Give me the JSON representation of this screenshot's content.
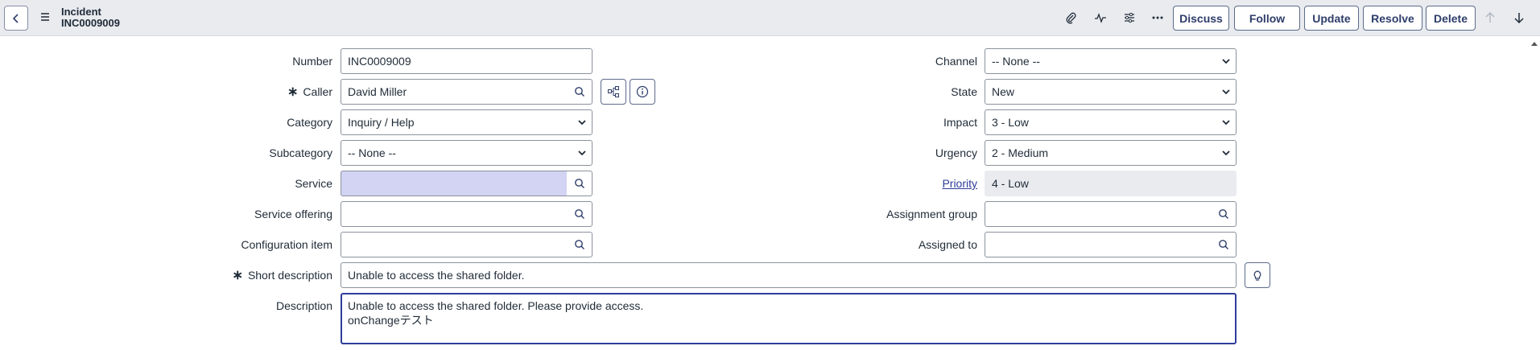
{
  "header": {
    "record_type": "Incident",
    "record_number": "INC0009009",
    "buttons": {
      "discuss": "Discuss",
      "follow": "Follow",
      "update": "Update",
      "resolve": "Resolve",
      "delete": "Delete"
    }
  },
  "form": {
    "number": {
      "label": "Number",
      "value": "INC0009009"
    },
    "caller": {
      "label": "Caller",
      "value": "David Miller"
    },
    "category": {
      "label": "Category",
      "value": "Inquiry / Help"
    },
    "subcategory": {
      "label": "Subcategory",
      "value": "-- None --"
    },
    "service": {
      "label": "Service",
      "value": ""
    },
    "service_offering": {
      "label": "Service offering",
      "value": ""
    },
    "configuration_item": {
      "label": "Configuration item",
      "value": ""
    },
    "channel": {
      "label": "Channel",
      "value": "-- None --"
    },
    "state": {
      "label": "State",
      "value": "New"
    },
    "impact": {
      "label": "Impact",
      "value": "3 - Low"
    },
    "urgency": {
      "label": "Urgency",
      "value": "2 - Medium"
    },
    "priority": {
      "label": "Priority",
      "value": "4 - Low"
    },
    "assignment_group": {
      "label": "Assignment group",
      "value": ""
    },
    "assigned_to": {
      "label": "Assigned to",
      "value": ""
    },
    "short_description": {
      "label": "Short description",
      "value": "Unable to access the shared folder."
    },
    "description": {
      "label": "Description",
      "value": "Unable to access the shared folder. Please provide access.\nonChangeテスト"
    },
    "required_marker": "∗"
  },
  "colors": {
    "accent": "#2e3d9a",
    "header_bg": "#e9ebef",
    "highlight": "#d3d3f3"
  }
}
